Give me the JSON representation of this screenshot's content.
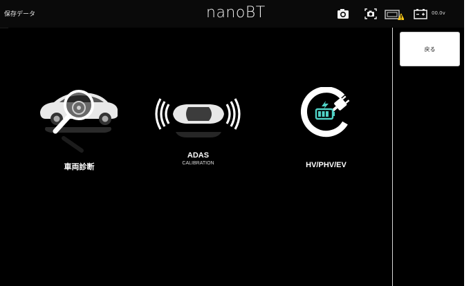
{
  "header": {
    "title": "保存データ",
    "brand": "nanoBT",
    "icons": [
      "camera-icon",
      "screenshot-icon",
      "vci-warning-icon",
      "battery-icon"
    ],
    "voltage": "00.0v"
  },
  "menu": {
    "items": [
      {
        "id": "vehicle-diagnosis",
        "label": "車両診断",
        "sublabel": "",
        "icon": "car-magnifier-icon"
      },
      {
        "id": "adas",
        "label": "ADAS",
        "sublabel": "CALIBRATION",
        "icon": "car-sensor-waves-icon"
      },
      {
        "id": "hv",
        "label": "HV/PHV/EV",
        "sublabel": "",
        "icon": "ev-plug-battery-icon"
      }
    ]
  },
  "sidebar": {
    "back_label": "戻る"
  },
  "colors": {
    "background": "#000000",
    "text": "#ffffff",
    "warning": "#f5c518",
    "ev_battery": "#4fd1c5"
  }
}
